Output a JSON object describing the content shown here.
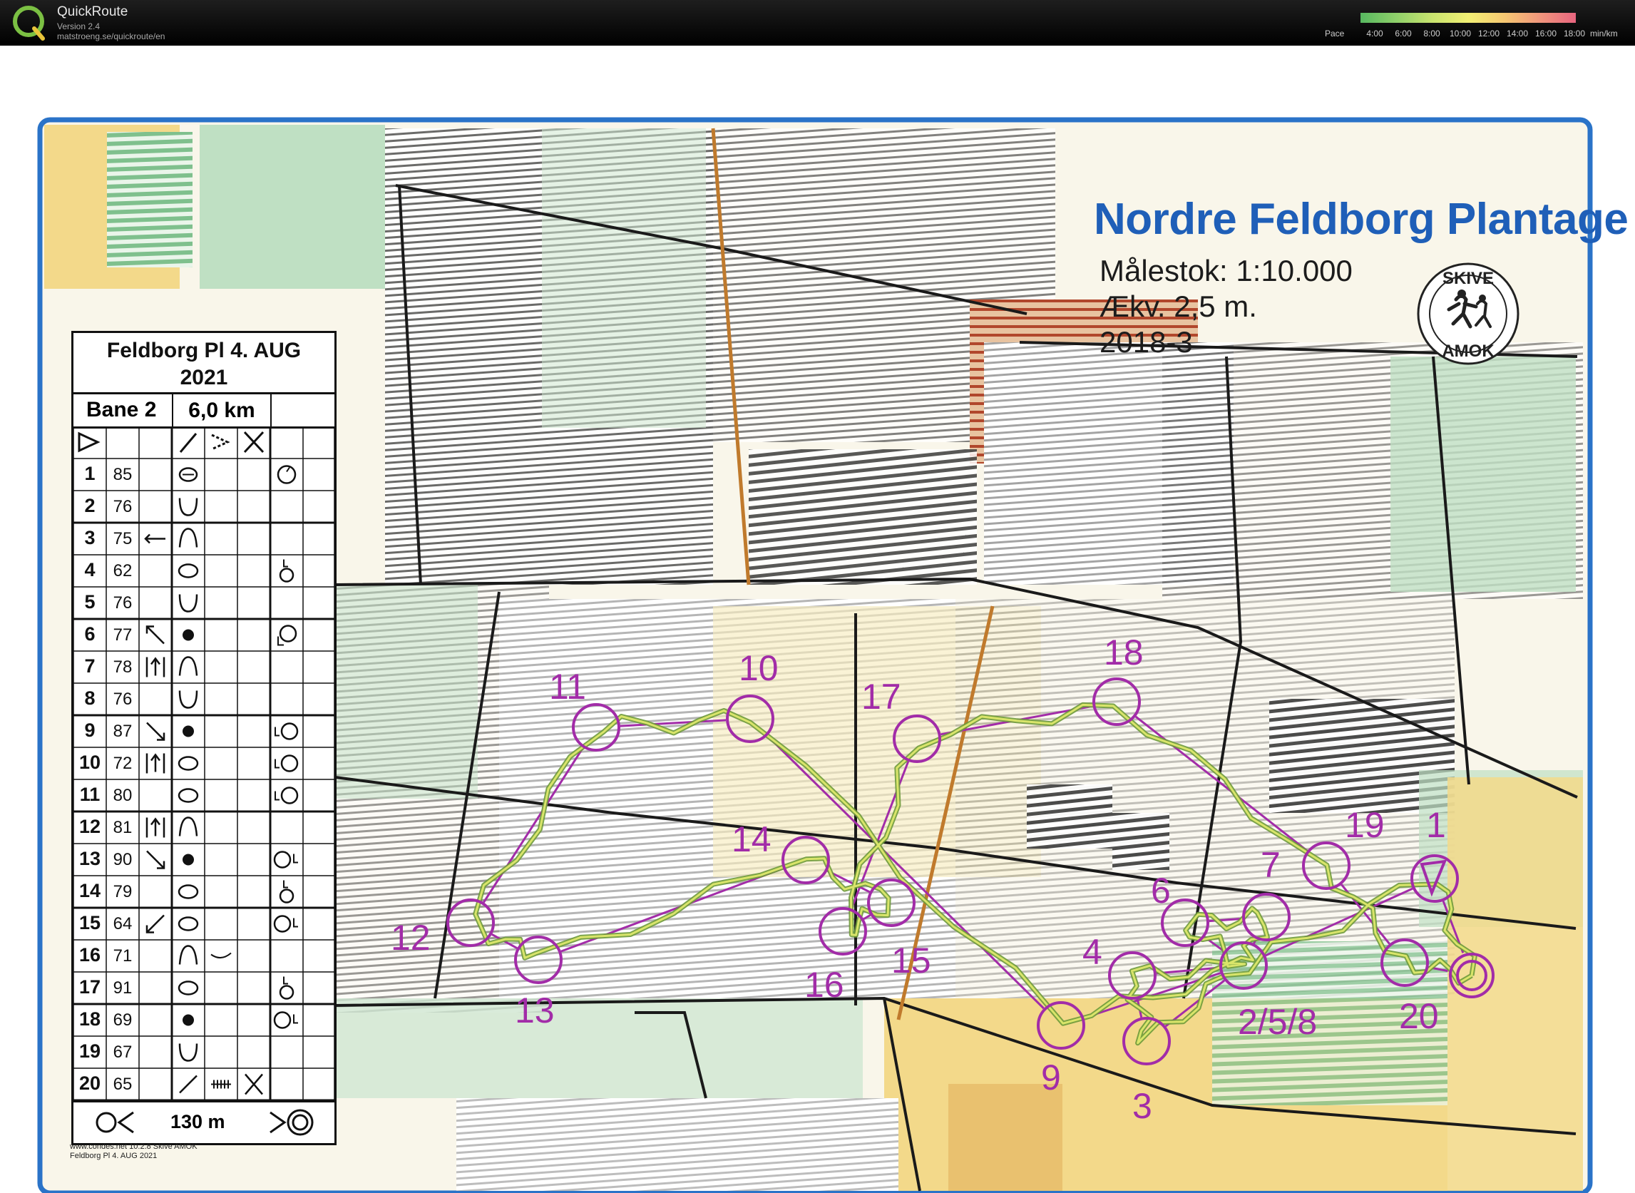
{
  "app": {
    "name": "QuickRoute",
    "version": "Version 2.4",
    "url": "matstroeng.se/quickroute/en",
    "pace_label": "Pace",
    "pace_ticks": [
      "4:00",
      "6:00",
      "8:00",
      "10:00",
      "12:00",
      "14:00",
      "16:00",
      "18:00"
    ],
    "pace_unit": "min/km"
  },
  "map": {
    "title": "Nordre Feldborg Plantage",
    "scale": "Målestok: 1:10.000",
    "contour": "Ækv. 2,5 m.",
    "edition": "2018-3",
    "club_logo_top": "SKIVE",
    "club_logo_bottom": "AMOK",
    "colors": {
      "course": "#a22ca8",
      "route": "#6e9a3a",
      "title": "#1f5fb8",
      "open_land": "#f3d98a",
      "forest_green": "#86c08f",
      "rough_open": "#f7ecc0"
    }
  },
  "control_sheet": {
    "title_line1": "Feldborg Pl 4. AUG",
    "title_line2": "2021",
    "course": "Bane 2",
    "length": "6,0 km",
    "controls": [
      {
        "num": "1",
        "code": "85",
        "dir": "",
        "feature": "knoll-pit",
        "detail": "",
        "extra": "ring"
      },
      {
        "num": "2",
        "code": "76",
        "dir": "",
        "feature": "pit-depression",
        "detail": "",
        "extra": ""
      },
      {
        "num": "3",
        "code": "75",
        "dir": "arrow-left",
        "feature": "knoll",
        "detail": "",
        "extra": ""
      },
      {
        "num": "4",
        "code": "62",
        "dir": "",
        "feature": "oval-thicket",
        "detail": "",
        "extra": "lower-part"
      },
      {
        "num": "5",
        "code": "76",
        "dir": "",
        "feature": "pit-depression",
        "detail": "",
        "extra": ""
      },
      {
        "num": "6",
        "code": "77",
        "dir": "arrow-nw",
        "feature": "dot",
        "detail": "",
        "extra": "corner"
      },
      {
        "num": "7",
        "code": "78",
        "dir": "between",
        "feature": "knoll",
        "detail": "",
        "extra": ""
      },
      {
        "num": "8",
        "code": "76",
        "dir": "",
        "feature": "pit-depression",
        "detail": "",
        "extra": ""
      },
      {
        "num": "9",
        "code": "87",
        "dir": "arrow-se",
        "feature": "dot",
        "detail": "",
        "extra": "side-left"
      },
      {
        "num": "10",
        "code": "72",
        "dir": "between",
        "feature": "oval-thicket",
        "detail": "",
        "extra": "side-left"
      },
      {
        "num": "11",
        "code": "80",
        "dir": "",
        "feature": "oval-thicket",
        "detail": "",
        "extra": "side-left"
      },
      {
        "num": "12",
        "code": "81",
        "dir": "between",
        "feature": "knoll",
        "detail": "",
        "extra": ""
      },
      {
        "num": "13",
        "code": "90",
        "dir": "arrow-se",
        "feature": "dot",
        "detail": "",
        "extra": "side-right"
      },
      {
        "num": "14",
        "code": "79",
        "dir": "",
        "feature": "oval-thicket",
        "detail": "",
        "extra": "lower-part"
      },
      {
        "num": "15",
        "code": "64",
        "dir": "arrow-sw",
        "feature": "oval-thicket",
        "detail": "",
        "extra": "side-right"
      },
      {
        "num": "16",
        "code": "71",
        "dir": "",
        "feature": "knoll",
        "detail": "curve",
        "extra": ""
      },
      {
        "num": "17",
        "code": "91",
        "dir": "",
        "feature": "oval-thicket",
        "detail": "",
        "extra": "lower-part"
      },
      {
        "num": "18",
        "code": "69",
        "dir": "",
        "feature": "dot",
        "detail": "",
        "extra": "side-right"
      },
      {
        "num": "19",
        "code": "67",
        "dir": "",
        "feature": "pit-depression",
        "detail": "",
        "extra": ""
      },
      {
        "num": "20",
        "code": "65",
        "dir": "",
        "feature": "line",
        "detail": "fence",
        "extra": "cross"
      }
    ],
    "finish_length": "130 m",
    "footer_line1": "www.condes.net 10.2.8 Skive AMOK",
    "footer_line2": "Feldborg Pl 4. AUG 2021"
  },
  "course": {
    "labels": [
      "11",
      "10",
      "17",
      "18",
      "14",
      "19",
      "1",
      "7",
      "6",
      "12",
      "16",
      "15",
      "4",
      "13",
      "2/5/8",
      "20",
      "9",
      "3"
    ]
  }
}
